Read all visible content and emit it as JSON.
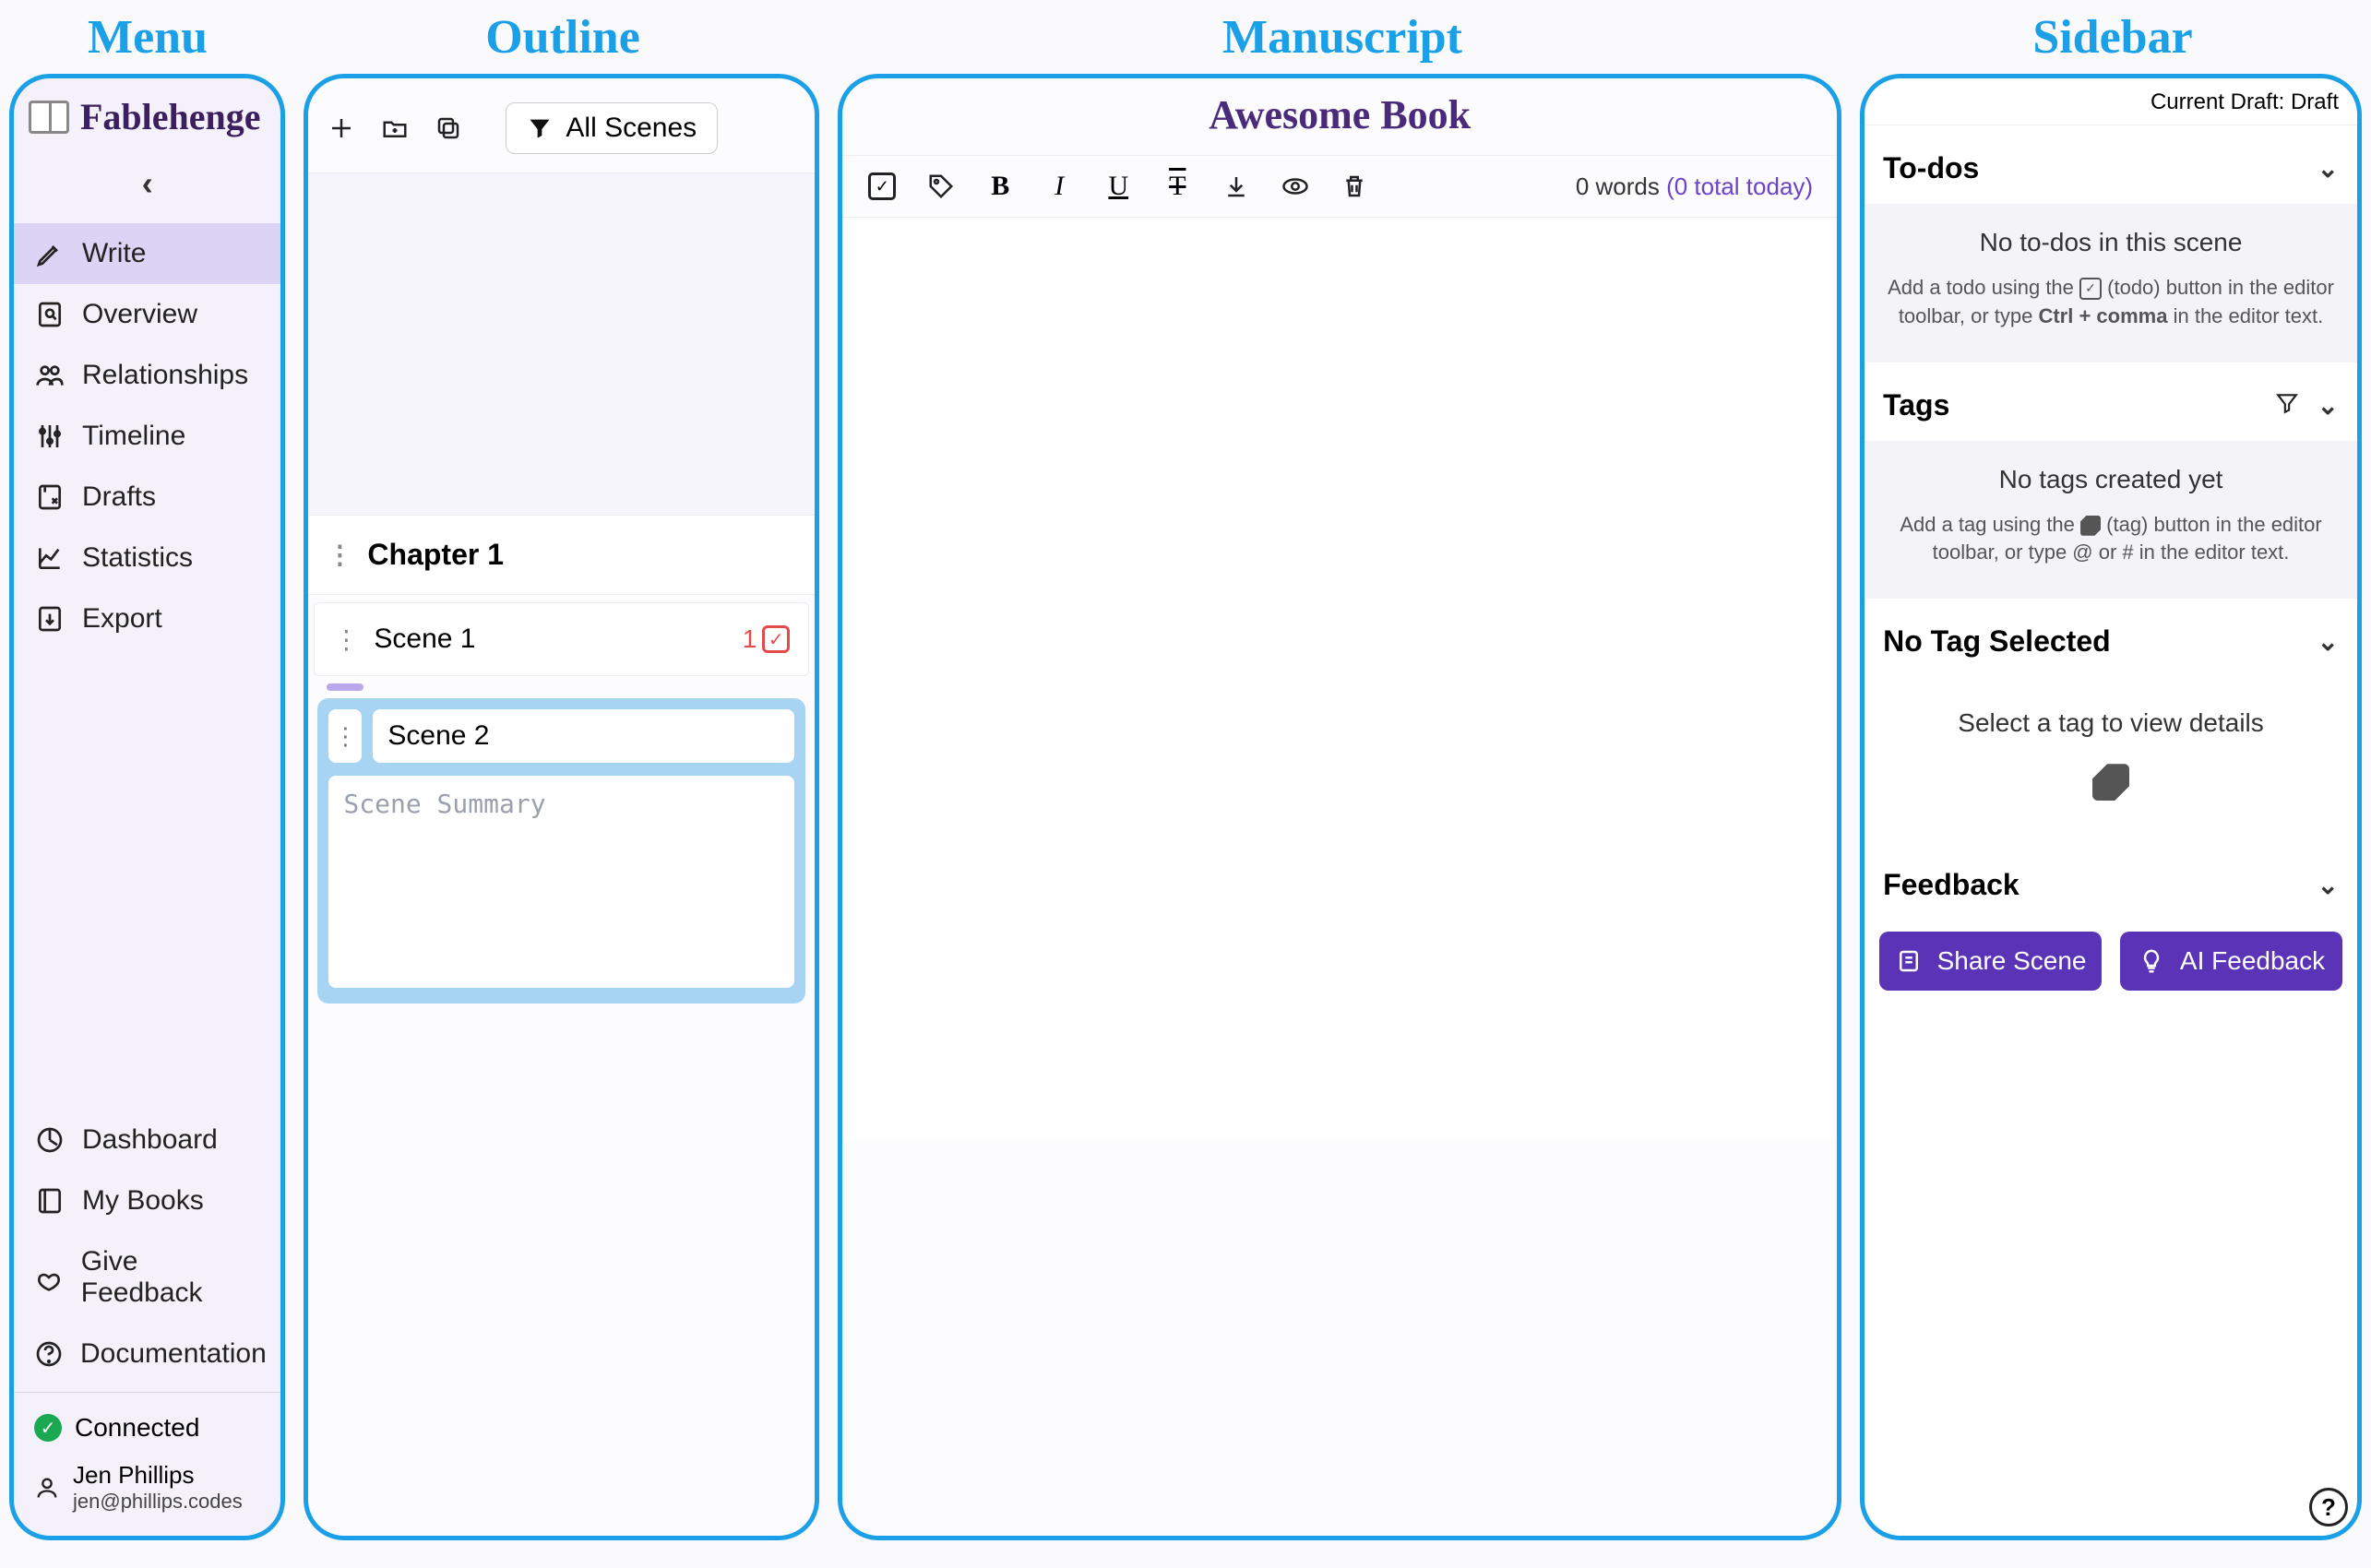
{
  "annotations": {
    "menu": "Menu",
    "outline": "Outline",
    "manuscript": "Manuscript",
    "sidebar": "Sidebar"
  },
  "brand": "Fablehenge",
  "nav": {
    "items": [
      {
        "label": "Write",
        "active": true
      },
      {
        "label": "Overview"
      },
      {
        "label": "Relationships"
      },
      {
        "label": "Timeline"
      },
      {
        "label": "Drafts"
      },
      {
        "label": "Statistics"
      },
      {
        "label": "Export"
      }
    ],
    "bottom": [
      {
        "label": "Dashboard"
      },
      {
        "label": "My Books"
      },
      {
        "label": "Give Feedback"
      },
      {
        "label": "Documentation"
      }
    ]
  },
  "status": "Connected",
  "user": {
    "name": "Jen Phillips",
    "email": "jen@phillips.codes"
  },
  "outline": {
    "filter_label": "All Scenes",
    "chapter": "Chapter 1",
    "scene1": {
      "title": "Scene 1",
      "todo_count": "1"
    },
    "scene2": {
      "title": "Scene 2",
      "summary_placeholder": "Scene Summary"
    }
  },
  "manuscript": {
    "title": "Awesome Book",
    "words": "0 words",
    "today": "(0 total today)"
  },
  "sidebar": {
    "draft_label": "Current Draft: Draft",
    "todos": {
      "title": "To-dos",
      "empty_title": "No to-dos in this scene",
      "help_pre": "Add a todo using the ",
      "help_mid": " (todo) button in the editor toolbar, or type ",
      "shortcut": "Ctrl + comma",
      "help_post": " in the editor text."
    },
    "tags": {
      "title": "Tags",
      "empty_title": "No tags created yet",
      "help_pre": "Add a tag using the ",
      "help_mid": " (tag) button in the editor toolbar, or type @ or # in the editor text."
    },
    "notag": {
      "title": "No Tag Selected",
      "body": "Select a tag to view details"
    },
    "feedback": {
      "title": "Feedback",
      "share": "Share Scene",
      "ai": "AI Feedback"
    }
  }
}
